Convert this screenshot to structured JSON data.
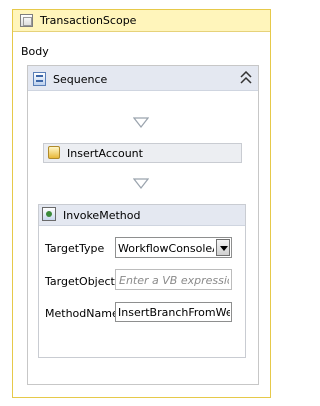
{
  "transaction_scope": {
    "title": "TransactionScope",
    "icon": "transaction-scope-icon"
  },
  "body_label": "Body",
  "sequence": {
    "title": "Sequence",
    "icon": "sequence-icon",
    "collapse_icon": "chevron-double-up-icon"
  },
  "insert_account": {
    "title": "InsertAccount",
    "icon": "activity-icon"
  },
  "invoke_method": {
    "title": "InvokeMethod",
    "icon": "invoke-method-icon",
    "target_type": {
      "label": "TargetType",
      "value": "WorkflowConsoleAp"
    },
    "target_object": {
      "label": "TargetObject",
      "placeholder": "Enter a VB expression"
    },
    "method_name": {
      "label": "MethodName",
      "value": "InsertBranchFromWebS"
    }
  },
  "colors": {
    "scope_header": "#fff5bb",
    "scope_border": "#e6c94a",
    "activity_header": "#e4e8f1"
  }
}
